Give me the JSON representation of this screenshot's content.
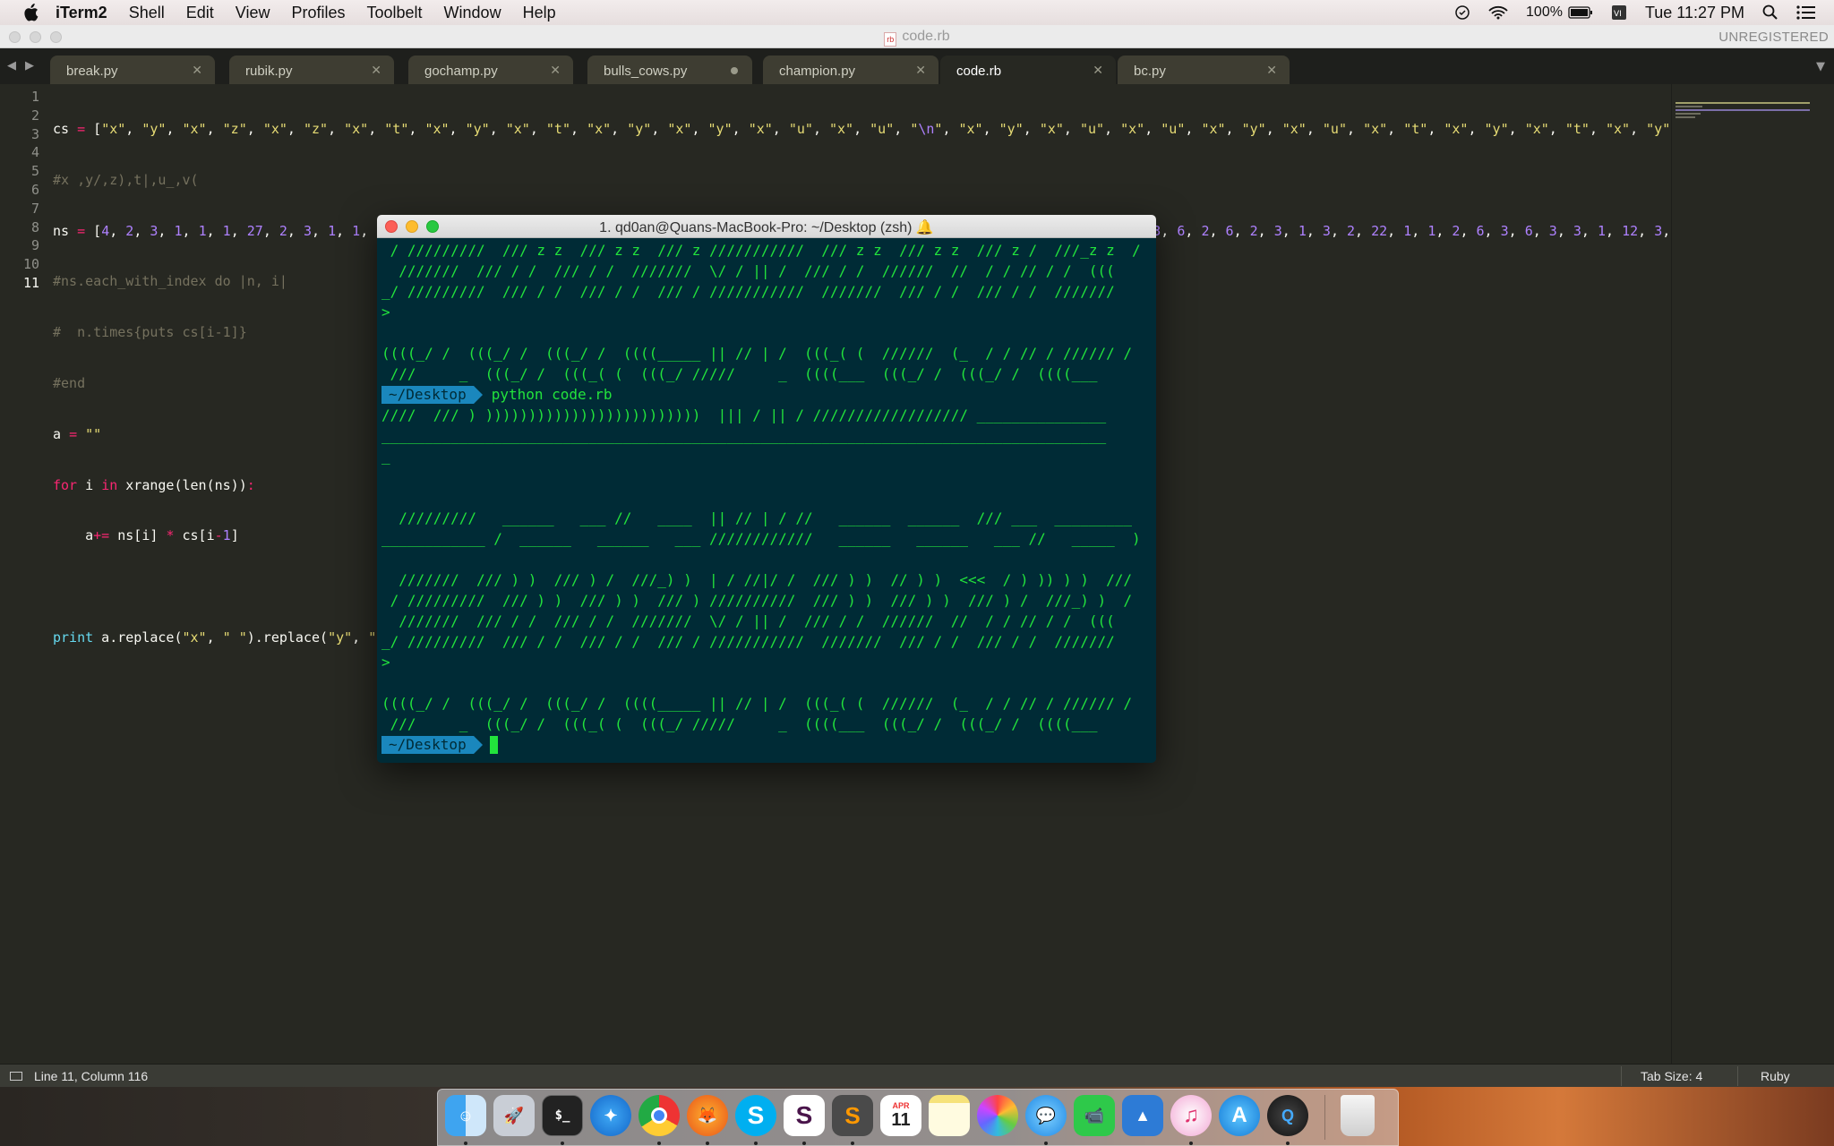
{
  "menubar": {
    "app_name": "iTerm2",
    "items": [
      "Shell",
      "Edit",
      "View",
      "Profiles",
      "Toolbelt",
      "Window",
      "Help"
    ],
    "battery": "100%",
    "clock": "Tue 11:27 PM"
  },
  "window": {
    "title": "code.rb",
    "unregistered": "UNREGISTERED"
  },
  "tabs": [
    {
      "label": "break.py",
      "state": "close"
    },
    {
      "label": "rubik.py",
      "state": "close"
    },
    {
      "label": "gochamp.py",
      "state": "close"
    },
    {
      "label": "bulls_cows.py",
      "state": "dirty"
    },
    {
      "label": "champion.py",
      "state": "close"
    },
    {
      "label": "code.rb",
      "state": "close",
      "active": true
    },
    {
      "label": "bc.py",
      "state": "close"
    }
  ],
  "editor": {
    "line_numbers": [
      "1",
      "2",
      "3",
      "4",
      "5",
      "6",
      "7",
      "8",
      "9",
      "10",
      "11"
    ],
    "current_line": "11"
  },
  "statusbar": {
    "position": "Line 11, Column 116",
    "tab_size": "Tab Size: 4",
    "syntax": "Ruby"
  },
  "iterm": {
    "title": "1. qd0an@Quans-MacBook-Pro: ~/Desktop (zsh) 🔔",
    "block1": " / /////////  /// z z  /// z z  /// z ///////////  /// z z  /// z z  /// z /  ///_z z  /\n  ///////  /// / /  /// / /  ///////  \\/ / || /  /// / /  //////  //  / / // / /  (((\n_/ /////////  /// / /  /// / /  /// / ///////////  ///////  /// / /  /// / /  ///////\n>\n\n((((_/ /  (((_/ /  (((_/ /  ((((_____ || // | /  (((_( (  //////  (_  / / // / ////// /\n ///     _  (((_/ /  (((_( (  (((_/ /////     _  ((((___  (((_/ /  (((_/ /  ((((___",
    "prompt_dir": "~/Desktop",
    "command": "python code.rb",
    "block2": "////  /// ) )))))))))))))))))))))))))  ||| / || / ////////////////// _______________\n____________________________________________________________________________________\n_\n\n\n  /////////   ______   ___ //   ____  || // | / //   ______  ______  /// ___  _________\n____________ /  ______   ______   ___ ////////////   ______   ______   ___ //   _____  )\n\n  ///////  /// ) )  /// ) /  ///_) )  | / //|/ /  /// ) )  // ) )  <<<  / ) )) ) )  ///\n / /////////  /// ) )  /// ) )  /// ) //////////  /// ) )  /// ) )  /// ) /  ///_) )  /\n  ///////  /// / /  /// / /  ///////  \\/ / || /  /// / /  //////  //  / / // / /  (((\n_/ /////////  /// / /  /// / /  /// / ///////////  ///////  /// / /  /// / /  ///////\n>\n\n((((_/ /  (((_/ /  (((_/ /  ((((_____ || // | /  (((_( (  //////  (_  / / // / ////// /\n ///     _  (((_/ /  (((_( (  (((_/ /////     _  ((((___  (((_/ /  (((_/ /  ((((___",
    "prompt_dir2": "~/Desktop"
  },
  "dock": {
    "apps": [
      "finder-icon",
      "launchpad-icon",
      "terminal-icon",
      "safari-icon",
      "chrome-icon",
      "firefox-icon",
      "skype-icon",
      "slack-icon",
      "sublime-icon",
      "calendar-icon",
      "notes-icon",
      "photos-icon",
      "messages-icon",
      "facetime-icon",
      "keynote-icon",
      "itunes-icon",
      "appstore-icon",
      "quicktime-icon",
      "trash-icon"
    ],
    "calendar_month": "APR",
    "calendar_day": "11"
  }
}
